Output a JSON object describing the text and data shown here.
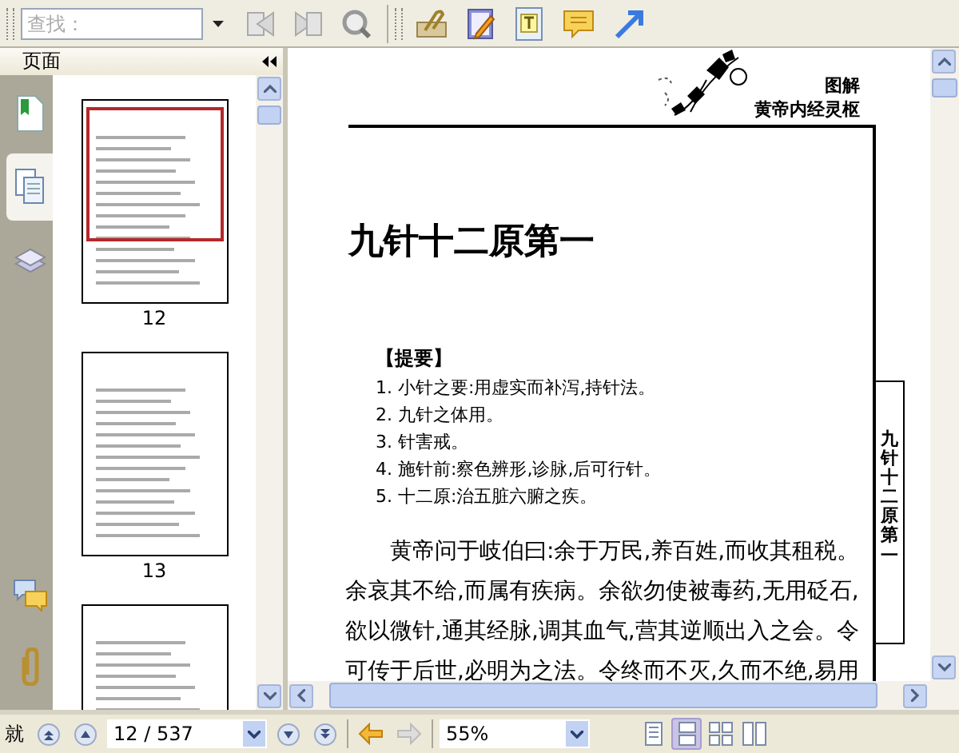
{
  "toolbar": {
    "search": {
      "placeholder": "查找："
    }
  },
  "sidebar": {
    "title": "页面",
    "tabs": [
      {
        "kind": "bookmarks",
        "selected": false
      },
      {
        "kind": "pages",
        "selected": true
      },
      {
        "kind": "layers",
        "selected": false
      }
    ],
    "bottom_tabs": [
      {
        "kind": "comments",
        "selected": false
      },
      {
        "kind": "attachments",
        "selected": false
      }
    ],
    "thumbnails": [
      {
        "label": "12",
        "selected": true
      },
      {
        "label": "13",
        "selected": false
      },
      {
        "selected": false
      }
    ]
  },
  "document": {
    "header": [
      "图解",
      "黄帝内经灵枢"
    ],
    "title": "九针十二原第一",
    "summary_heading": "【提要】",
    "summary": [
      "1. 小针之要:用虚实而补泻,持针法。",
      "2. 九针之体用。",
      "3. 针害戒。",
      "4. 施针前:察色辨形,诊脉,后可行针。",
      "5. 十二原:治五脏六腑之疾。"
    ],
    "paragraph": "黄帝问于岐伯曰:余于万民,养百姓,而收其租税。余哀其不给,而属有疾病。余欲勿使被毒药,无用砭石,欲以微针,通其经脉,调其血气,营其逆顺出入之会。令可传于后世,必明为之法。令终而不灭,久而不绝,易用",
    "side_tab": "九针十二原第一"
  },
  "status_bar": {
    "status": "就",
    "page": "12 / 537",
    "zoom": "55%",
    "view_modes": [
      {
        "kind": "single",
        "selected": false
      },
      {
        "kind": "continuous",
        "selected": true
      },
      {
        "kind": "facing",
        "selected": false
      },
      {
        "kind": "continuous_facing",
        "selected": false
      }
    ]
  }
}
